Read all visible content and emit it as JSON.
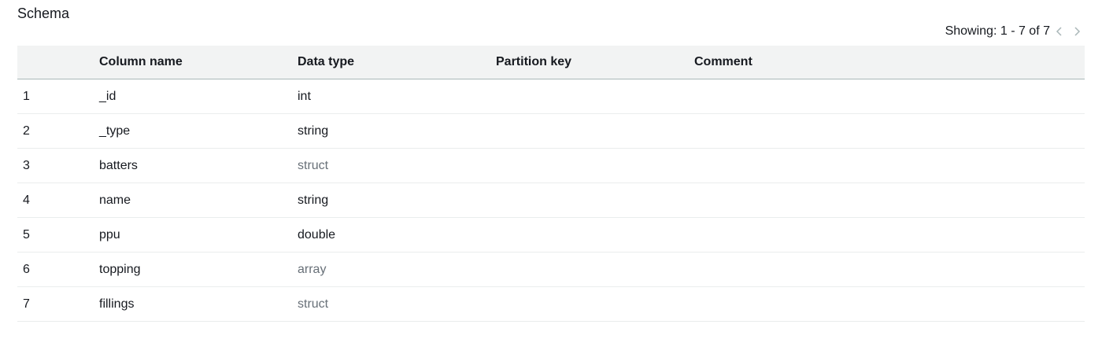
{
  "title": "Schema",
  "pagination": {
    "text": "Showing: 1 - 7 of 7",
    "prev_icon": "chevron-left-icon",
    "next_icon": "chevron-right-icon"
  },
  "table": {
    "headers": {
      "index": "",
      "column_name": "Column name",
      "data_type": "Data type",
      "partition_key": "Partition key",
      "comment": "Comment"
    },
    "rows": [
      {
        "index": "1",
        "column_name": "_id",
        "data_type": "int",
        "partition_key": "",
        "comment": ""
      },
      {
        "index": "2",
        "column_name": "_type",
        "data_type": "string",
        "partition_key": "",
        "comment": ""
      },
      {
        "index": "3",
        "column_name": "batters",
        "data_type": "struct",
        "partition_key": "",
        "comment": ""
      },
      {
        "index": "4",
        "column_name": "name",
        "data_type": "string",
        "partition_key": "",
        "comment": ""
      },
      {
        "index": "5",
        "column_name": "ppu",
        "data_type": "double",
        "partition_key": "",
        "comment": ""
      },
      {
        "index": "6",
        "column_name": "topping",
        "data_type": "array",
        "partition_key": "",
        "comment": ""
      },
      {
        "index": "7",
        "column_name": "fillings",
        "data_type": "struct",
        "partition_key": "",
        "comment": ""
      }
    ]
  },
  "colors": {
    "text": "#16191f",
    "complex_type": "#687078",
    "header_bg": "#f2f3f3",
    "row_border": "#eaeded",
    "header_border": "#aab7b8",
    "pager_disabled": "#aab7b8"
  }
}
